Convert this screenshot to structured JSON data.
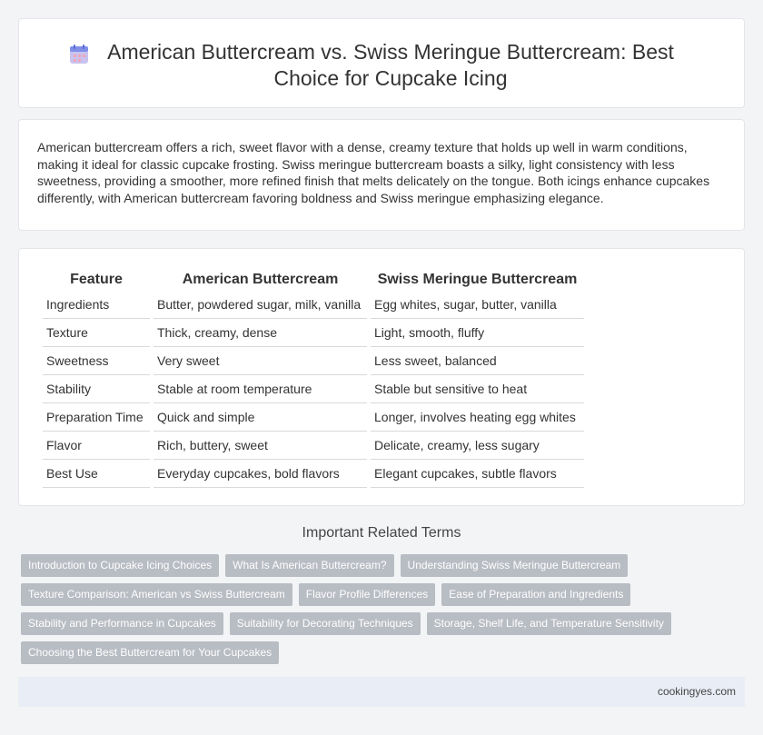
{
  "header": {
    "icon": "calendar-icon",
    "title": "American Buttercream vs. Swiss Meringue Buttercream: Best Choice for Cupcake Icing"
  },
  "intro": {
    "text": "American buttercream offers a rich, sweet flavor with a dense, creamy texture that holds up well in warm conditions, making it ideal for classic cupcake frosting. Swiss meringue buttercream boasts a silky, light consistency with less sweetness, providing a smoother, more refined finish that melts delicately on the tongue. Both icings enhance cupcakes differently, with American buttercream favoring boldness and Swiss meringue emphasizing elegance."
  },
  "table": {
    "headers": [
      "Feature",
      "American Buttercream",
      "Swiss Meringue Buttercream"
    ],
    "rows": [
      [
        "Ingredients",
        "Butter, powdered sugar, milk, vanilla",
        "Egg whites, sugar, butter, vanilla"
      ],
      [
        "Texture",
        "Thick, creamy, dense",
        "Light, smooth, fluffy"
      ],
      [
        "Sweetness",
        "Very sweet",
        "Less sweet, balanced"
      ],
      [
        "Stability",
        "Stable at room temperature",
        "Stable but sensitive to heat"
      ],
      [
        "Preparation Time",
        "Quick and simple",
        "Longer, involves heating egg whites"
      ],
      [
        "Flavor",
        "Rich, buttery, sweet",
        "Delicate, creamy, less sugary"
      ],
      [
        "Best Use",
        "Everyday cupcakes, bold flavors",
        "Elegant cupcakes, subtle flavors"
      ]
    ]
  },
  "related": {
    "title": "Important Related Terms",
    "rows": [
      [
        "Introduction to Cupcake Icing Choices",
        "What Is American Buttercream?",
        "Understanding Swiss Meringue Buttercream"
      ],
      [
        "Texture Comparison: American vs Swiss Buttercream",
        "Flavor Profile Differences",
        "Ease of Preparation and Ingredients"
      ],
      [
        "Stability and Performance in Cupcakes",
        "Suitability for Decorating Techniques",
        "Storage, Shelf Life, and Temperature Sensitivity"
      ],
      [
        "Choosing the Best Buttercream for Your Cupcakes"
      ]
    ]
  },
  "footer": {
    "site": "cookingyes.com"
  }
}
